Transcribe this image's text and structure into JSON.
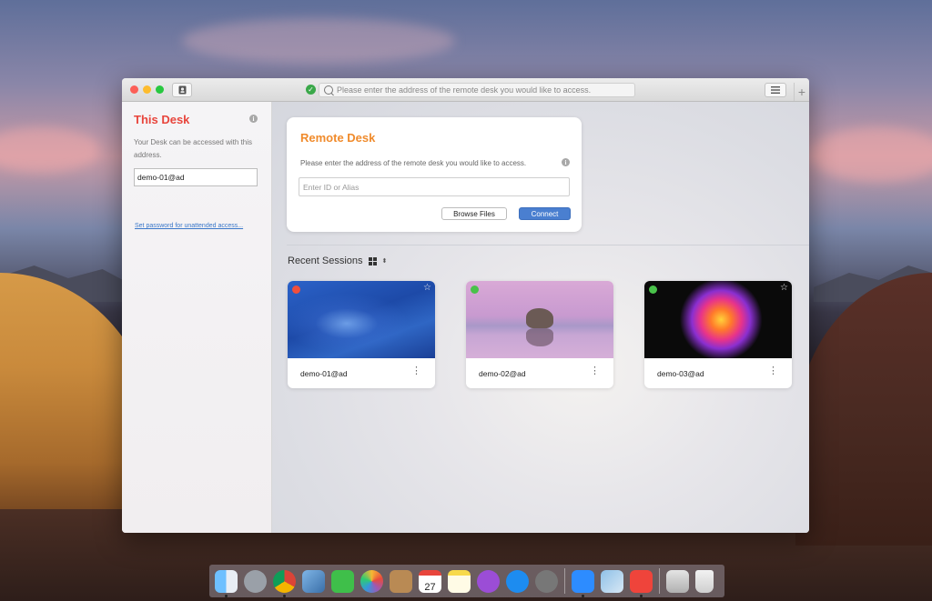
{
  "window": {
    "address_placeholder": "Please enter the address of the remote desk you would like to access."
  },
  "sidebar": {
    "title": "This Desk",
    "description": "Your Desk can be accessed with this address.",
    "address_value": "demo-01@ad",
    "password_link": "Set password for unattended access..."
  },
  "remote_card": {
    "title": "Remote Desk",
    "description": "Please enter the address of the remote desk you would like to access.",
    "input_placeholder": "Enter ID or Alias",
    "browse_label": "Browse Files",
    "connect_label": "Connect"
  },
  "recent": {
    "title": "Recent Sessions",
    "sessions": [
      {
        "label": "demo-01@ad",
        "status": "offline",
        "status_color": "#f04f3c"
      },
      {
        "label": "demo-02@ad",
        "status": "online",
        "status_color": "#49c24a"
      },
      {
        "label": "demo-03@ad",
        "status": "online",
        "status_color": "#49c24a"
      }
    ]
  },
  "dock": {
    "items": [
      "finder-icon",
      "launchpad-icon",
      "chrome-icon",
      "preview-icon",
      "facetime-icon",
      "photos-icon",
      "contacts-icon",
      "calendar-icon",
      "notes-icon",
      "podcasts-icon",
      "app-store-icon",
      "system-preferences-icon",
      "zoom-icon",
      "image-capture-icon",
      "anydesk-icon",
      "downloads-stack-icon",
      "trash-icon"
    ],
    "calendar_day": "27"
  },
  "colors": {
    "accent_red": "#e8453c",
    "accent_orange": "#f08b2c",
    "connect_blue": "#4a7fd0",
    "link_blue": "#3a77c9"
  }
}
